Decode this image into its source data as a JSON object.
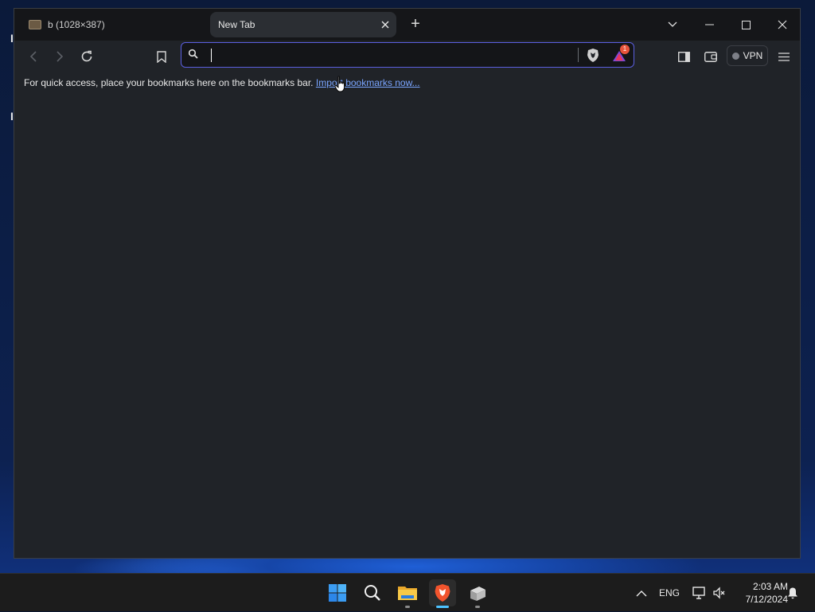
{
  "desktop": {
    "icon_fragments": [
      "I",
      "I"
    ]
  },
  "browser": {
    "tabs": [
      {
        "title": "b (1028×387)",
        "active": false
      },
      {
        "title": "New Tab",
        "active": true
      }
    ],
    "new_tab_label": "+",
    "omnibox": {
      "value": "",
      "placeholder": ""
    },
    "vpn_label": "VPN",
    "rewards_badge": "1",
    "bookmarks_bar": {
      "message": "For quick access, place your bookmarks here on the bookmarks bar.",
      "link": "Import bookmarks now..."
    }
  },
  "taskbar": {
    "apps": [
      "start-icon",
      "search-icon",
      "file-explorer-icon",
      "brave-browser-icon",
      "app-icon"
    ],
    "language": "ENG",
    "time": "2:03 AM",
    "date": "7/12/2024"
  },
  "colors": {
    "accent": "#5b5fe0",
    "link": "#7aa5ff",
    "window_bg": "#202328",
    "taskbar_active": "#4cc2ff"
  }
}
